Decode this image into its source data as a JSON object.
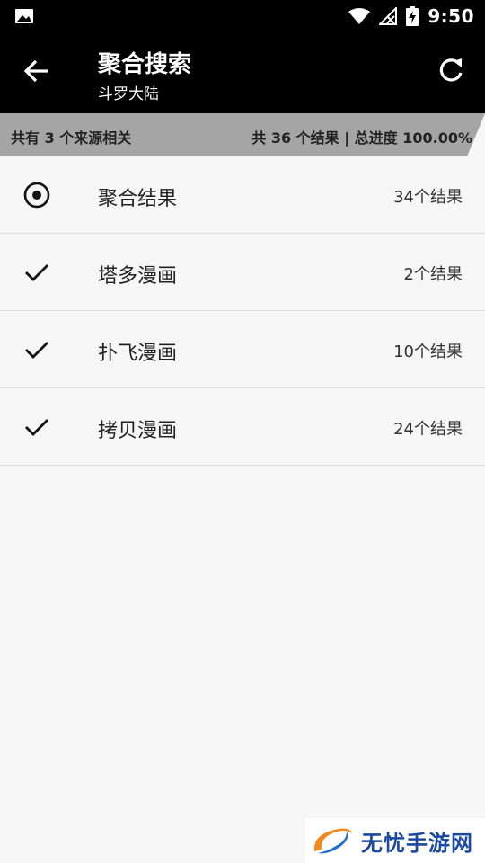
{
  "status_bar": {
    "time": "9:50",
    "icons": [
      "image-icon",
      "wifi-icon",
      "no-signal-icon",
      "battery-charging-icon"
    ]
  },
  "toolbar": {
    "title": "聚合搜索",
    "subtitle": "斗罗大陆",
    "back_icon": "arrow-back-icon",
    "refresh_icon": "refresh-icon"
  },
  "info_bar": {
    "left": "共有 3 个来源相关",
    "right": "共 36 个结果 | 总进度 100.00%",
    "progress": 1.0
  },
  "list": {
    "items": [
      {
        "name": "聚合结果",
        "count": "34个结果",
        "icon": "radio-selected-icon"
      },
      {
        "name": "塔多漫画",
        "count": "2个结果",
        "icon": "check-icon"
      },
      {
        "name": "扑飞漫画",
        "count": "10个结果",
        "icon": "check-icon"
      },
      {
        "name": "拷贝漫画",
        "count": "24个结果",
        "icon": "check-icon"
      }
    ]
  },
  "watermark": {
    "text": "无忧手游网"
  },
  "colors": {
    "toolbar_bg": "#000000",
    "infobar_bg": "#a5a5a5",
    "page_bg": "#f6f6f6",
    "watermark_text": "#1b4aa0"
  }
}
